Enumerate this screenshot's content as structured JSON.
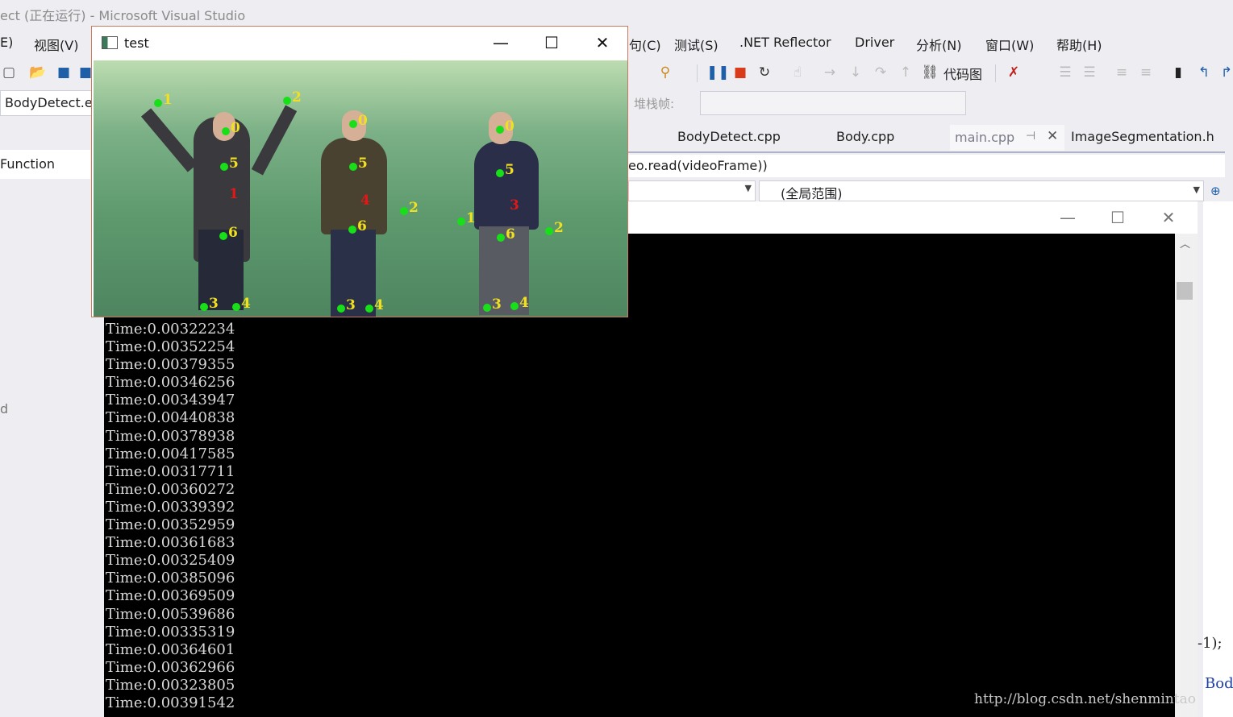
{
  "vs": {
    "title": "ect (正在运行) - Microsoft Visual Studio",
    "menu": [
      "E)",
      "视图(V)",
      "句(C)",
      "测试(S)",
      ".NET Reflector",
      "Driver",
      "分析(N)",
      "窗口(W)",
      "帮助(H)"
    ],
    "toolbar": {
      "code_map_label": "代码图",
      "stack_frame_label": "堆栈帧:"
    },
    "project_combo": "BodyDetect.e",
    "function_label": "Function",
    "left_fragment": "d",
    "tabs": [
      "BodyDetect.cpp",
      "Body.cpp",
      "main.cpp",
      "ImageSegmentation.h"
    ],
    "code_line": "eo.read(videoFrame))",
    "scope_combo": "(全局范围)",
    "right_fragment_1": "-1);",
    "right_fragment_2": "Bod"
  },
  "test_window": {
    "title": "test",
    "people": [
      {
        "keypoints": [
          {
            "label": "1",
            "color": "yellow"
          },
          {
            "label": "2",
            "color": "yellow"
          },
          {
            "label": "0",
            "color": "yellow"
          },
          {
            "label": "5",
            "color": "yellow"
          },
          {
            "label": "1",
            "color": "red"
          },
          {
            "label": "6",
            "color": "yellow"
          },
          {
            "label": "3",
            "color": "yellow"
          },
          {
            "label": "4",
            "color": "yellow"
          }
        ]
      },
      {
        "keypoints": [
          {
            "label": "0",
            "color": "yellow"
          },
          {
            "label": "5",
            "color": "yellow"
          },
          {
            "label": "4",
            "color": "red"
          },
          {
            "label": "2",
            "color": "yellow"
          },
          {
            "label": "6",
            "color": "yellow"
          },
          {
            "label": "3",
            "color": "yellow"
          },
          {
            "label": "4",
            "color": "yellow"
          }
        ]
      },
      {
        "keypoints": [
          {
            "label": "0",
            "color": "yellow"
          },
          {
            "label": "5",
            "color": "yellow"
          },
          {
            "label": "3",
            "color": "red"
          },
          {
            "label": "1",
            "color": "yellow"
          },
          {
            "label": "2",
            "color": "yellow"
          },
          {
            "label": "6",
            "color": "yellow"
          },
          {
            "label": "3",
            "color": "yellow"
          },
          {
            "label": "4",
            "color": "yellow"
          }
        ]
      }
    ]
  },
  "console": {
    "lines": [
      "Time:0.00322234",
      "Time:0.00352254",
      "Time:0.00379355",
      "Time:0.00346256",
      "Time:0.00343947",
      "Time:0.00440838",
      "Time:0.00378938",
      "Time:0.00417585",
      "Time:0.00317711",
      "Time:0.00360272",
      "Time:0.00339392",
      "Time:0.00352959",
      "Time:0.00361683",
      "Time:0.00325409",
      "Time:0.00385096",
      "Time:0.00369509",
      "Time:0.00539686",
      "Time:0.00335319",
      "Time:0.00364601",
      "Time:0.00362966",
      "Time:0.00323805",
      "Time:0.00391542"
    ]
  },
  "watermark": "http://blog.csdn.net/shenmintao"
}
